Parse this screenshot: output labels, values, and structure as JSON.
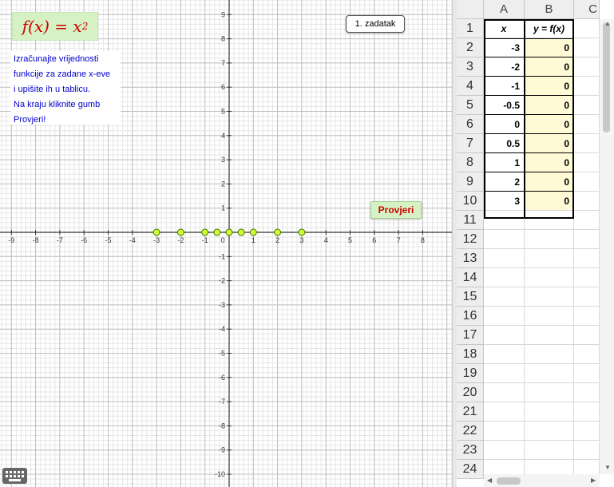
{
  "graphics": {
    "formula": {
      "lhs": "f(x) = x",
      "exp": "2"
    },
    "instructions": [
      "Izračunajte vrijednosti",
      "funkcije za zadane x-eve",
      "i upišite ih u tablicu.",
      "Na kraju kliknite gumb",
      "Provjeri!"
    ],
    "task_button": "1. zadatak",
    "check_button": "Provjeri",
    "x_ticks": [
      "-9",
      "-8",
      "-7",
      "-6",
      "-5",
      "-4",
      "-3",
      "-2",
      "-1",
      "0",
      "1",
      "2",
      "3",
      "4",
      "5",
      "6",
      "7",
      "8"
    ],
    "y_ticks_pos": [
      "9",
      "8",
      "7",
      "6",
      "5",
      "4",
      "3",
      "2",
      "1"
    ],
    "y_ticks_neg": [
      "-1",
      "-2",
      "-3",
      "-4",
      "-5",
      "-6",
      "-7",
      "-8",
      "-9",
      "-10"
    ],
    "points": [
      -3,
      -2,
      -1,
      -0.5,
      0,
      0.5,
      1,
      2,
      3
    ],
    "point_color": "#ccff33",
    "keyboard_icon": "keyboard-icon"
  },
  "sheet": {
    "columns": [
      "A",
      "B",
      "C"
    ],
    "header_row": {
      "a": "x",
      "b": "y = f(x)"
    },
    "rows": [
      {
        "a": "-3",
        "b": "0"
      },
      {
        "a": "-2",
        "b": "0"
      },
      {
        "a": "-1",
        "b": "0"
      },
      {
        "a": "-0.5",
        "b": "0"
      },
      {
        "a": "0",
        "b": "0"
      },
      {
        "a": "0.5",
        "b": "0"
      },
      {
        "a": "1",
        "b": "0"
      },
      {
        "a": "2",
        "b": "0"
      },
      {
        "a": "3",
        "b": "0"
      }
    ],
    "row_numbers": [
      "1",
      "2",
      "3",
      "4",
      "5",
      "6",
      "7",
      "8",
      "9",
      "10",
      "11",
      "12",
      "13",
      "14",
      "15",
      "16",
      "17",
      "18",
      "19",
      "20",
      "21",
      "22",
      "23",
      "24"
    ],
    "input_color": "#fff9d6"
  }
}
